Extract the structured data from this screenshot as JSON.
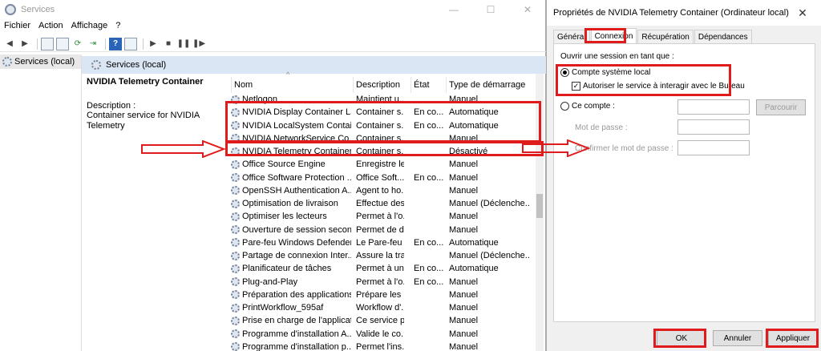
{
  "services_window": {
    "title": "Services",
    "controls": [
      "—",
      "☐",
      "✕"
    ],
    "menu": [
      "Fichier",
      "Action",
      "Affichage",
      "?"
    ],
    "tree_root": "Services (local)",
    "main_header": "Services (local)",
    "selected_service": {
      "name": "NVIDIA Telemetry Container",
      "description_label": "Description :",
      "description_text": "Container service for NVIDIA Telemetry"
    },
    "columns": [
      "Nom",
      "Description",
      "État",
      "Type de démarrage"
    ],
    "rows": [
      {
        "name": "Netlogon",
        "desc": "Maintient u...",
        "state": "",
        "start": "Manuel"
      },
      {
        "name": "NVIDIA Display Container LS",
        "desc": "Container s...",
        "state": "En co...",
        "start": "Automatique"
      },
      {
        "name": "NVIDIA LocalSystem Contai...",
        "desc": "Container s...",
        "state": "En co...",
        "start": "Automatique"
      },
      {
        "name": "NVIDIA NetworkService Co...",
        "desc": "Container s...",
        "state": "",
        "start": "Manuel"
      },
      {
        "name": "NVIDIA Telemetry Container",
        "desc": "Container s...",
        "state": "",
        "start": "Désactivé"
      },
      {
        "name": "Office  Source Engine",
        "desc": "Enregistre le...",
        "state": "",
        "start": "Manuel"
      },
      {
        "name": "Office Software Protection ...",
        "desc": "Office Soft...",
        "state": "En co...",
        "start": "Manuel"
      },
      {
        "name": "OpenSSH Authentication A...",
        "desc": "Agent to ho...",
        "state": "",
        "start": "Manuel"
      },
      {
        "name": "Optimisation de livraison",
        "desc": "Effectue des...",
        "state": "",
        "start": "Manuel (Déclenche..."
      },
      {
        "name": "Optimiser les lecteurs",
        "desc": "Permet à l'o...",
        "state": "",
        "start": "Manuel"
      },
      {
        "name": "Ouverture de session secon...",
        "desc": "Permet de d...",
        "state": "",
        "start": "Manuel"
      },
      {
        "name": "Pare-feu Windows Defender",
        "desc": "Le Pare-feu ...",
        "state": "En co...",
        "start": "Automatique"
      },
      {
        "name": "Partage de connexion Inter...",
        "desc": "Assure la tra...",
        "state": "",
        "start": "Manuel (Déclenche..."
      },
      {
        "name": "Planificateur de tâches",
        "desc": "Permet à un...",
        "state": "En co...",
        "start": "Automatique"
      },
      {
        "name": "Plug-and-Play",
        "desc": "Permet à l'o...",
        "state": "En co...",
        "start": "Manuel"
      },
      {
        "name": "Préparation des applications",
        "desc": "Prépare les ...",
        "state": "",
        "start": "Manuel"
      },
      {
        "name": "PrintWorkflow_595af",
        "desc": "Workflow d'...",
        "state": "",
        "start": "Manuel"
      },
      {
        "name": "Prise en charge de l'applicat...",
        "desc": "Ce service p...",
        "state": "",
        "start": "Manuel"
      },
      {
        "name": "Programme d'installation A...",
        "desc": "Valide le co...",
        "state": "",
        "start": "Manuel"
      },
      {
        "name": "Programme d'installation p...",
        "desc": "Permet l'ins...",
        "state": "",
        "start": "Manuel"
      }
    ]
  },
  "dialog": {
    "title": "Propriétés de NVIDIA Telemetry Container (Ordinateur local)",
    "close": "✕",
    "tabs": [
      "Général",
      "Connexion",
      "Récupération",
      "Dépendances"
    ],
    "logon_label": "Ouvrir une session en tant que :",
    "local_system": "Compte système local",
    "interact_desktop": "Autoriser le service à interagir avec le Bureau",
    "this_account": "Ce compte :",
    "browse": "Parcourir",
    "password": "Mot de passe :",
    "confirm_password": "Confirmer le mot de passe :",
    "ok": "OK",
    "cancel": "Annuler",
    "apply": "Appliquer"
  },
  "colors": {
    "annotation_red": "#e01b1b",
    "header_blue": "#dbe6f4"
  }
}
